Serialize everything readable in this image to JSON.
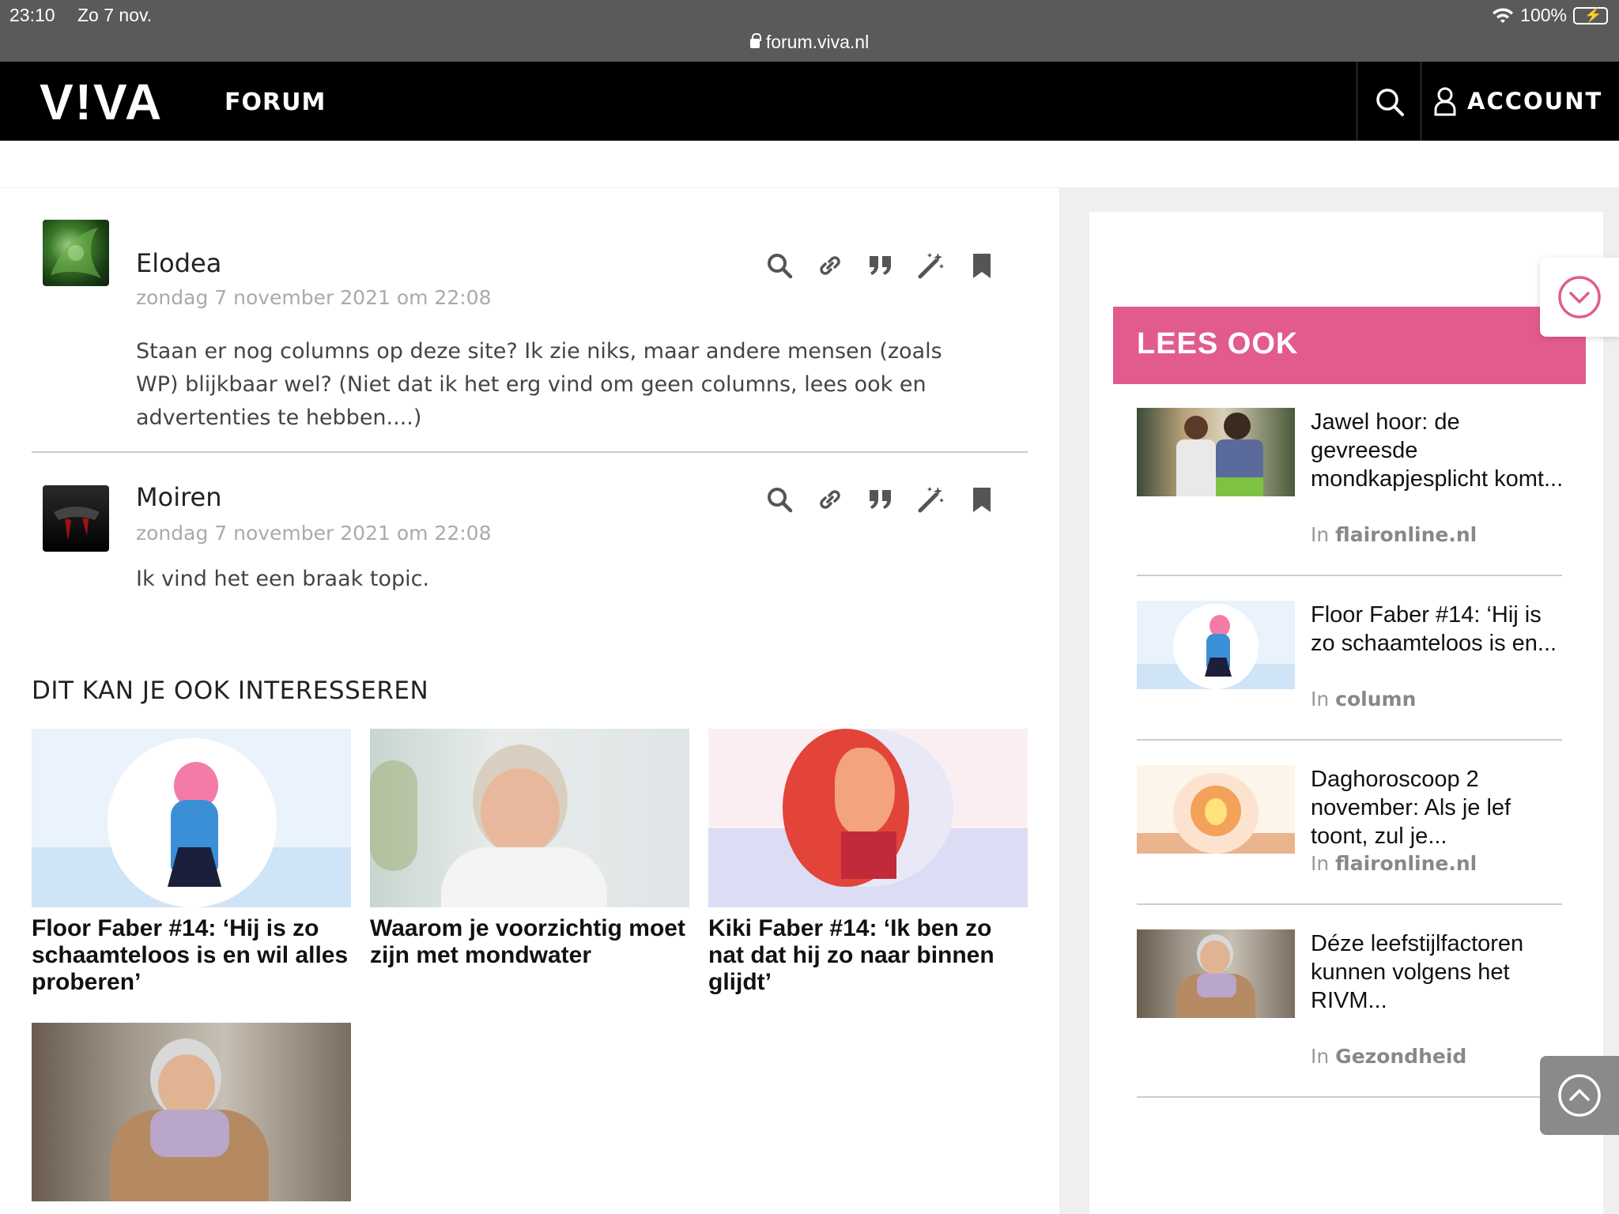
{
  "status": {
    "time": "23:10",
    "date": "Zo 7 nov.",
    "battery": "100%",
    "url": "forum.viva.nl"
  },
  "header": {
    "logo": "V!VA",
    "forum": "FORUM",
    "account": "ACCOUNT"
  },
  "posts": [
    {
      "author": "Elodea",
      "date": "zondag 7 november 2021 om 22:08",
      "text": "Staan er nog columns op deze site? Ik zie niks, maar andere mensen (zoals WP) blijkbaar wel? (Niet dat ik het erg vind om geen columns, lees ook en advertenties te hebben....)"
    },
    {
      "author": "Moiren",
      "date": "zondag 7 november 2021 om 22:08",
      "text": "Ik vind het een braak topic."
    }
  ],
  "interest": {
    "title": "DIT KAN JE OOK INTERESSEREN",
    "cards": [
      {
        "title": "Floor Faber #14: ‘Hij is zo schaamteloos is en wil alles proberen’"
      },
      {
        "title": "Waarom je voorzichtig moet zijn met mondwater"
      },
      {
        "title": "Kiki Faber #14: ‘Ik ben zo nat dat hij zo naar binnen glijdt’"
      },
      {
        "title": ""
      }
    ]
  },
  "sidebar": {
    "title": "LEES OOK",
    "items": [
      {
        "title": "Jawel hoor: de gevreesde mondkapjesplicht komt...",
        "prefix": "In",
        "source": "flaironline.nl"
      },
      {
        "title": "Floor Faber #14: ‘Hij is zo schaamteloos is en...",
        "prefix": "In",
        "source": "column"
      },
      {
        "title": "Daghoroscoop 2 november: Als je lef toont, zul je...",
        "prefix": "In",
        "source": "flaironline.nl"
      },
      {
        "title": "Déze leefstijlfactoren kunnen volgens het RIVM...",
        "prefix": "In",
        "source": "Gezondheid"
      }
    ]
  },
  "colors": {
    "accent": "#e25b8e",
    "header": "#000000"
  }
}
